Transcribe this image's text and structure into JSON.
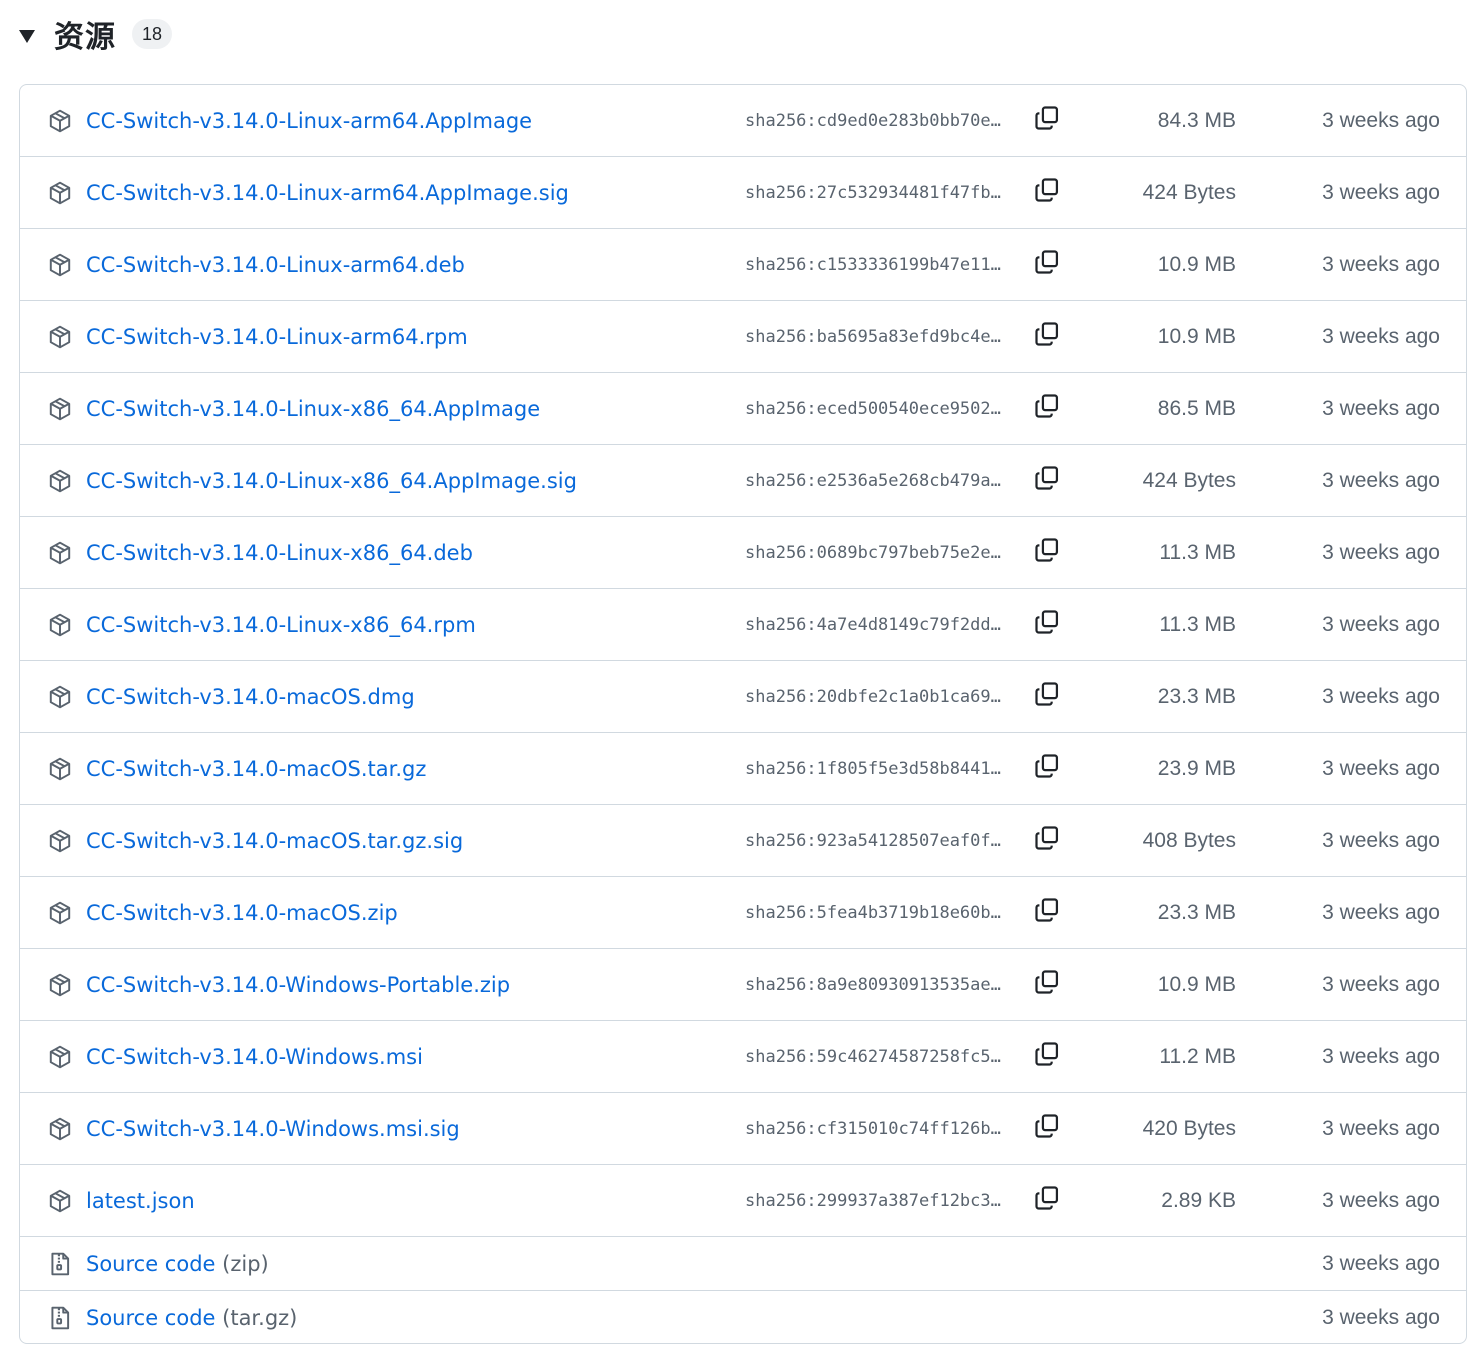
{
  "header": {
    "title": "资源",
    "count": "18"
  },
  "colors": {
    "link": "#0969da",
    "muted": "#59636e",
    "border": "#d1d9e0",
    "badge_bg": "#eff1f3"
  },
  "assets": [
    {
      "name": "CC-Switch-v3.14.0-Linux-arm64.AppImage",
      "sha": "sha256:cd9ed0e283b0bb70e…",
      "size": "84.3 MB",
      "time": "3 weeks ago",
      "icon": "package-icon"
    },
    {
      "name": "CC-Switch-v3.14.0-Linux-arm64.AppImage.sig",
      "sha": "sha256:27c532934481f47fb…",
      "size": "424 Bytes",
      "time": "3 weeks ago",
      "icon": "package-icon"
    },
    {
      "name": "CC-Switch-v3.14.0-Linux-arm64.deb",
      "sha": "sha256:c1533336199b47e11…",
      "size": "10.9 MB",
      "time": "3 weeks ago",
      "icon": "package-icon"
    },
    {
      "name": "CC-Switch-v3.14.0-Linux-arm64.rpm",
      "sha": "sha256:ba5695a83efd9bc4e…",
      "size": "10.9 MB",
      "time": "3 weeks ago",
      "icon": "package-icon"
    },
    {
      "name": "CC-Switch-v3.14.0-Linux-x86_64.AppImage",
      "sha": "sha256:eced500540ece9502…",
      "size": "86.5 MB",
      "time": "3 weeks ago",
      "icon": "package-icon"
    },
    {
      "name": "CC-Switch-v3.14.0-Linux-x86_64.AppImage.sig",
      "sha": "sha256:e2536a5e268cb479a…",
      "size": "424 Bytes",
      "time": "3 weeks ago",
      "icon": "package-icon"
    },
    {
      "name": "CC-Switch-v3.14.0-Linux-x86_64.deb",
      "sha": "sha256:0689bc797beb75e2e…",
      "size": "11.3 MB",
      "time": "3 weeks ago",
      "icon": "package-icon"
    },
    {
      "name": "CC-Switch-v3.14.0-Linux-x86_64.rpm",
      "sha": "sha256:4a7e4d8149c79f2dd…",
      "size": "11.3 MB",
      "time": "3 weeks ago",
      "icon": "package-icon"
    },
    {
      "name": "CC-Switch-v3.14.0-macOS.dmg",
      "sha": "sha256:20dbfe2c1a0b1ca69…",
      "size": "23.3 MB",
      "time": "3 weeks ago",
      "icon": "package-icon"
    },
    {
      "name": "CC-Switch-v3.14.0-macOS.tar.gz",
      "sha": "sha256:1f805f5e3d58b8441…",
      "size": "23.9 MB",
      "time": "3 weeks ago",
      "icon": "package-icon"
    },
    {
      "name": "CC-Switch-v3.14.0-macOS.tar.gz.sig",
      "sha": "sha256:923a54128507eaf0f…",
      "size": "408 Bytes",
      "time": "3 weeks ago",
      "icon": "package-icon"
    },
    {
      "name": "CC-Switch-v3.14.0-macOS.zip",
      "sha": "sha256:5fea4b3719b18e60b…",
      "size": "23.3 MB",
      "time": "3 weeks ago",
      "icon": "package-icon"
    },
    {
      "name": "CC-Switch-v3.14.0-Windows-Portable.zip",
      "sha": "sha256:8a9e80930913535ae…",
      "size": "10.9 MB",
      "time": "3 weeks ago",
      "icon": "package-icon"
    },
    {
      "name": "CC-Switch-v3.14.0-Windows.msi",
      "sha": "sha256:59c46274587258fc5…",
      "size": "11.2 MB",
      "time": "3 weeks ago",
      "icon": "package-icon"
    },
    {
      "name": "CC-Switch-v3.14.0-Windows.msi.sig",
      "sha": "sha256:cf315010c74ff126b…",
      "size": "420 Bytes",
      "time": "3 weeks ago",
      "icon": "package-icon"
    },
    {
      "name": "latest.json",
      "sha": "sha256:299937a387ef12bc3…",
      "size": "2.89 KB",
      "time": "3 weeks ago",
      "icon": "package-icon"
    }
  ],
  "source_code": [
    {
      "name": "Source code",
      "suffix": "(zip)",
      "time": "3 weeks ago",
      "icon": "file-zip-icon"
    },
    {
      "name": "Source code",
      "suffix": "(tar.gz)",
      "time": "3 weeks ago",
      "icon": "file-zip-icon"
    }
  ]
}
